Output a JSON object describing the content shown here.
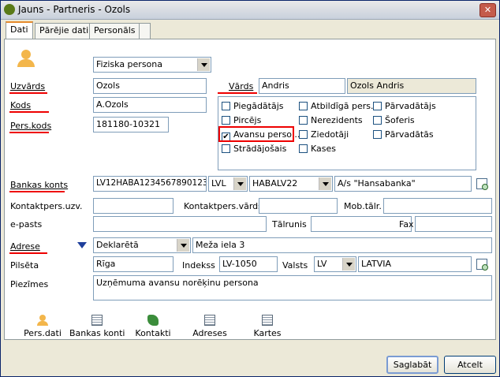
{
  "window": {
    "title": "Jauns - Partneris - Ozols",
    "close": "✕"
  },
  "tabs": [
    "Dati",
    "Pārējie dati",
    "Personāls"
  ],
  "person_type": {
    "value": "Fiziska persona"
  },
  "labels": {
    "uzvards": "Uzvārds",
    "kods": "Kods",
    "pers_kods": "Pers.kods",
    "vards": "Vārds",
    "bankas_konts": "Bankas konts",
    "kontaktpers_uzv": "Kontaktpers.uzv.",
    "kontaktpers_vards": "Kontaktpers.vārds",
    "mob_talr": "Mob.tālr.",
    "e_pasts": "e-pasts",
    "talrunis": "Tālrunis",
    "fax": "Fax",
    "adrese": "Adrese",
    "pilseta": "Pilsēta",
    "indekss": "Indekss",
    "valsts": "Valsts",
    "piezimes": "Piezīmes"
  },
  "values": {
    "uzvards": "Ozols",
    "kods": "A.Ozols",
    "pers_kods": "181180-10321",
    "vards": "Andris",
    "full_name": "Ozols Andris",
    "bank_account": "LV12HABA1234567890123",
    "currency": "LVL",
    "bank_code": "HABALV22",
    "bank_name": "A/s \"Hansabanka\"",
    "kontaktpers_uzv": "",
    "kontaktpers_vards": "",
    "mob_talr": "",
    "e_pasts": "",
    "talrunis": "",
    "fax": "",
    "address_type": "Deklarētā",
    "address": "Meža iela 3",
    "city": "Rīga",
    "index": "LV-1050",
    "country_code": "LV",
    "country": "LATVIA",
    "notes": "Uzņēmuma avansu norēķinu persona"
  },
  "roles": [
    {
      "label": "Piegādātājs",
      "checked": false
    },
    {
      "label": "Atbildīgā pers...",
      "checked": false
    },
    {
      "label": "Pārvadātājs",
      "checked": false
    },
    {
      "label": "Pircējs",
      "checked": false
    },
    {
      "label": "Nerezidents",
      "checked": false
    },
    {
      "label": "Šoferis",
      "checked": false
    },
    {
      "label": "Avansu perso...",
      "checked": true
    },
    {
      "label": "Ziedotāji",
      "checked": false
    },
    {
      "label": "Pārvadātās",
      "checked": false
    },
    {
      "label": "Strādājošais",
      "checked": false
    },
    {
      "label": "Kases",
      "checked": false
    }
  ],
  "bottom_tools": [
    "Pers.dati",
    "Bankas konti",
    "Kontakti",
    "Adreses",
    "Kartes"
  ],
  "buttons": {
    "save": "Saglabāt",
    "cancel": "Atcelt"
  },
  "colors": {
    "highlight": "#e00000",
    "tab_accent": "#e68b2c"
  }
}
